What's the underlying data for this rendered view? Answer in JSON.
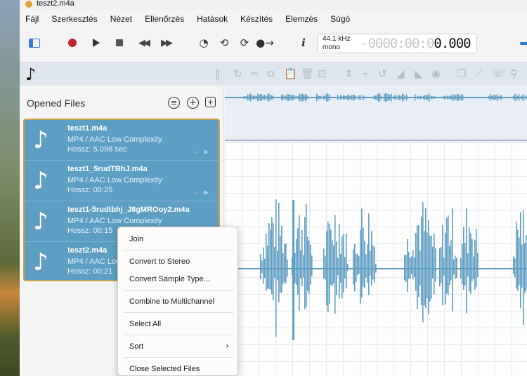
{
  "window": {
    "title": "teszt2.m4a"
  },
  "menu": [
    "Fájl",
    "Szerkesztés",
    "Nézet",
    "Ellenőrzés",
    "Hatások",
    "Készítés",
    "Elemzés",
    "Súgó"
  ],
  "transport": {
    "sample_rate": "44.1 kHz",
    "channels": "mono",
    "time_ghost": "-0000:00:0",
    "time_value": "0.000"
  },
  "sidebar": {
    "title": "Opened Files",
    "files": [
      {
        "name": "teszt1.m4a",
        "format": "MP4 / AAC Low Complexity",
        "length": "Hossz: 5.098 sec"
      },
      {
        "name": "teszt1_5rudTBhJ.m4a",
        "format": "MP4 / AAC Low Complexity",
        "length": "Hossz: 00:25"
      },
      {
        "name": "teszt1-5rudtbhj_J8gMROoy2.m4a",
        "format": "MP4 / AAC Low Complexity",
        "length": "Hossz: 00:15"
      },
      {
        "name": "teszt2.m4a",
        "format": "MP4 / AAC Low Complexity",
        "length": "Hossz: 00:21"
      }
    ]
  },
  "context_menu": {
    "items": [
      "Join",
      "Convert to Stereo",
      "Convert Sample Type...",
      "Combine to Multichannel",
      "Select All",
      "Sort",
      "Close Selected Files"
    ]
  },
  "colors": {
    "waveform": "#5e9ec3",
    "selection": "#5e9ec3",
    "accent": "#2c78d4",
    "record": "#c0232f"
  }
}
